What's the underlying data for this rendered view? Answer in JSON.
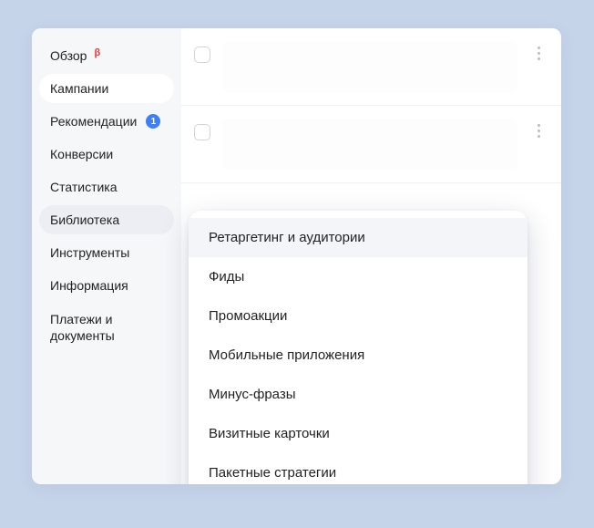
{
  "sidebar": {
    "items": [
      {
        "label": "Обзор",
        "beta": "β"
      },
      {
        "label": "Кампании"
      },
      {
        "label": "Рекомендации",
        "badge": "1"
      },
      {
        "label": "Конверсии"
      },
      {
        "label": "Статистика"
      },
      {
        "label": "Библиотека"
      },
      {
        "label": "Инструменты"
      },
      {
        "label": "Информация"
      },
      {
        "label": "Платежи и документы"
      }
    ]
  },
  "dropdown": {
    "items": [
      {
        "label": "Ретаргетинг и аудитории"
      },
      {
        "label": "Фиды"
      },
      {
        "label": "Промоакции"
      },
      {
        "label": "Мобильные приложения"
      },
      {
        "label": "Минус-фразы"
      },
      {
        "label": "Визитные карточки"
      },
      {
        "label": "Пакетные стратегии"
      }
    ]
  }
}
